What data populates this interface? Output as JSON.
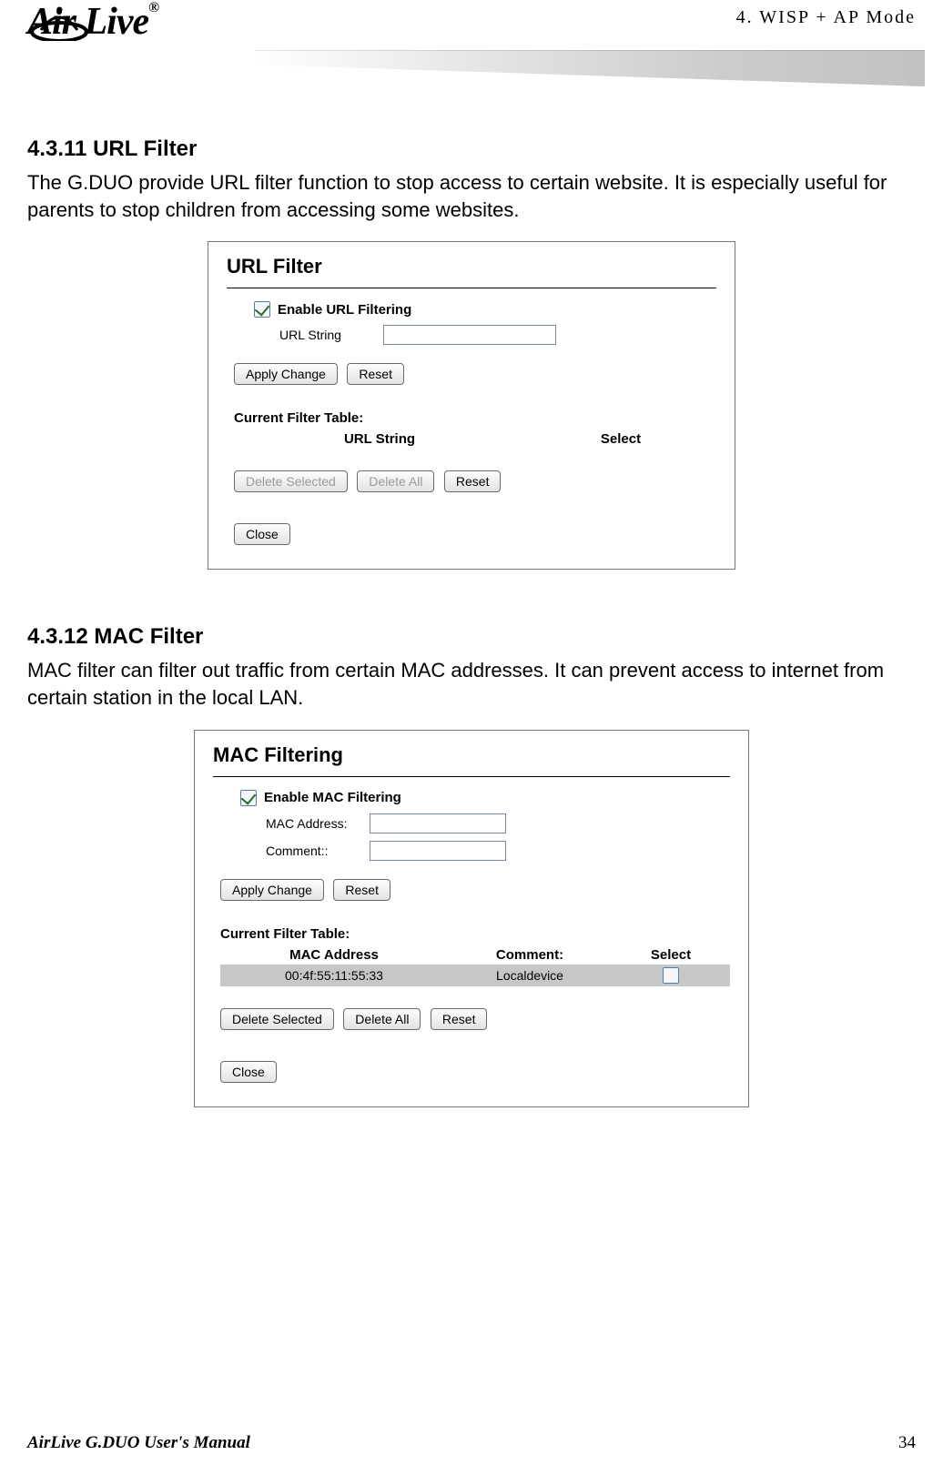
{
  "header": {
    "logo_text": "Air Live",
    "logo_reg": "®",
    "breadcrumb": "4. WISP + AP Mode"
  },
  "sections": {
    "url": {
      "heading": "4.3.11 URL Filter",
      "text": "The G.DUO provide URL filter function to stop access to certain website.    It is especially useful for parents to stop children from accessing some websites.",
      "panel_title": "URL Filter",
      "enable_label": "Enable URL Filtering",
      "enable_checked": true,
      "url_string_label": "URL String",
      "apply_btn": "Apply Change",
      "reset_btn": "Reset",
      "table_title": "Current Filter Table:",
      "col_url": "URL String",
      "col_select": "Select",
      "delete_selected_btn": "Delete Selected",
      "delete_all_btn": "Delete All",
      "reset2_btn": "Reset",
      "close_btn": "Close"
    },
    "mac": {
      "heading": "4.3.12 MAC Filter",
      "text": "MAC filter can filter out traffic from certain MAC addresses.    It can prevent access to internet from certain station in the local LAN.",
      "panel_title": "MAC Filtering",
      "enable_label": "Enable MAC Filtering",
      "enable_checked": true,
      "mac_label": "MAC Address:",
      "comment_label": "Comment::",
      "apply_btn": "Apply Change",
      "reset_btn": "Reset",
      "table_title": "Current Filter Table:",
      "col_mac": "MAC Address",
      "col_comment": "Comment:",
      "col_select": "Select",
      "rows": [
        {
          "mac": "00:4f:55:11:55:33",
          "comment": "Localdevice",
          "selected": false
        }
      ],
      "delete_selected_btn": "Delete Selected",
      "delete_all_btn": "Delete All",
      "reset2_btn": "Reset",
      "close_btn": "Close"
    }
  },
  "footer": {
    "manual_title": "AirLive G.DUO User's Manual",
    "page_number": "34"
  }
}
